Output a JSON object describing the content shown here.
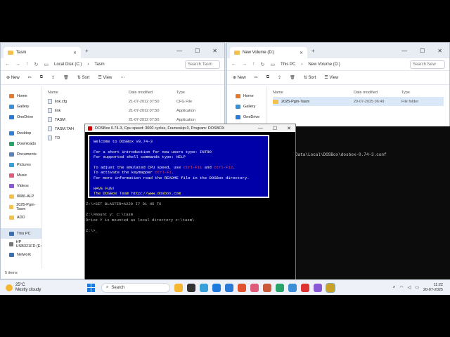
{
  "left_explorer": {
    "tab_title": "Tasm",
    "crumbs": [
      "Local Disk (C:)",
      "Tasm"
    ],
    "search_placeholder": "Search Tasm",
    "toolbar": {
      "new": "New",
      "sort": "Sort",
      "view": "View"
    },
    "nav": [
      {
        "label": "Home",
        "color": "#e07a2e"
      },
      {
        "label": "Gallery",
        "color": "#3c8fd6"
      },
      {
        "label": "OneDrive",
        "color": "#2a7ad6"
      },
      {
        "label": "Desktop",
        "color": "#2f7fd8"
      },
      {
        "label": "Downloads",
        "color": "#2aa36b"
      },
      {
        "label": "Documents",
        "color": "#5b7fb8"
      },
      {
        "label": "Pictures",
        "color": "#3aa0d8"
      },
      {
        "label": "Music",
        "color": "#e05a7a"
      },
      {
        "label": "Videos",
        "color": "#8a5ad6"
      },
      {
        "label": "8086-ALP",
        "color": "#f2c14e"
      },
      {
        "label": "2025-Pgm-Tasm",
        "color": "#f2c14e"
      },
      {
        "label": "ADD",
        "color": "#f2c14e"
      },
      {
        "label": "This PC",
        "color": "#3c6fb0"
      },
      {
        "label": "HP USB321FD (E:",
        "color": "#777"
      },
      {
        "label": "Network",
        "color": "#3c6fb0"
      }
    ],
    "columns": [
      "Name",
      "Date modified",
      "Type"
    ],
    "files": [
      {
        "name": "link.cfg",
        "date": "21-07-2012 07:50",
        "type": "CFG File"
      },
      {
        "name": "link",
        "date": "21-07-2012 07:50",
        "type": "Application"
      },
      {
        "name": "TASM",
        "date": "21-07-2012 07:50",
        "type": "Application"
      },
      {
        "name": "TASM.TAH",
        "date": "",
        "type": ""
      },
      {
        "name": "TD",
        "date": "",
        "type": ""
      }
    ],
    "status": "5 items"
  },
  "right_explorer": {
    "tab_title": "New Volume (D:)",
    "crumbs": [
      "This PC",
      "New Volume (D:)"
    ],
    "search_placeholder": "Search New",
    "toolbar": {
      "new": "New",
      "sort": "Sort",
      "view": "View"
    },
    "nav": [
      {
        "label": "Home",
        "color": "#e07a2e"
      },
      {
        "label": "Gallery",
        "color": "#3c8fd6"
      },
      {
        "label": "OneDrive",
        "color": "#2a7ad6"
      }
    ],
    "columns": [
      "Name",
      "Date modified",
      "Type"
    ],
    "files": [
      {
        "name": "2025-Pgm-Tasm",
        "date": "20-07-2025 06:49",
        "type": "File folder"
      }
    ]
  },
  "console": {
    "text": "Data\\Local\\DOSBox\\dosbox-0.74-3.conf"
  },
  "dosbox": {
    "title": "DOSBox 0.74-3, Cpu speed:   3000 cycles, Frameskip  0, Program:   DOSBOX",
    "welcome_title": "Welcome to DOSBox v0.74-3",
    "l1": "For a short introduction for new users type: INTRO",
    "l2": "For supported shell commands type: HELP",
    "l3a": "To adjust the emulated CPU speed, use ",
    "l3b": "ctrl-F11",
    "l3c": " and ",
    "l3d": "ctrl-F12",
    "l3e": ".",
    "l4a": "To activate the keymapper ",
    "l4b": "ctrl-F1",
    "l4c": ".",
    "l5": "For more information read the README file in the DOSBox directory.",
    "l6": "HAVE FUN!",
    "l7": "The DOSBox Team http://www.dosbox.com",
    "output": "Z:\\>SET BLASTER=A220 I7 D1 H5 T6\n\nZ:\\>mount y: c:\\tasm\nDrive Y is mounted as local directory c:\\tasm\\\n\nZ:\\>_"
  },
  "taskbar": {
    "temp": "25°C",
    "weather": "Mostly cloudy",
    "search": "Search",
    "time": "11:22",
    "date": "20-07-2025",
    "apps": [
      "#f5b731",
      "#333",
      "#3aa0d8",
      "#1f7ae0",
      "#2a7ad6",
      "#e0532e",
      "#e05a7a",
      "#c95a3a",
      "#2aa36b",
      "#3c8fd6",
      "#d33",
      "#8a5ad6",
      "#c9a227"
    ]
  }
}
